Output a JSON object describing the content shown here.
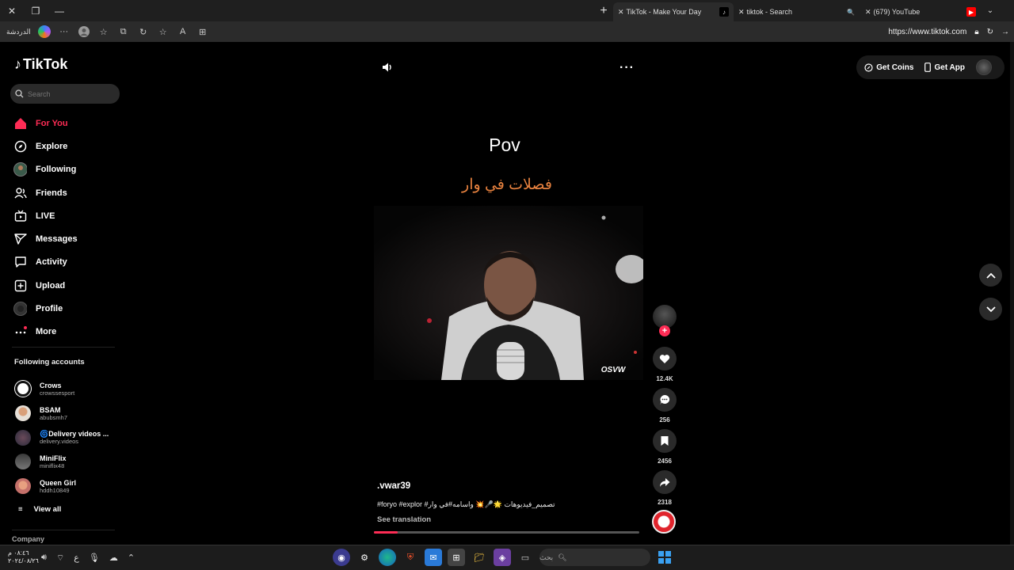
{
  "browser": {
    "tabs": [
      {
        "title": "TikTok - Make Your Day",
        "active": true
      },
      {
        "title": "tiktok - Search",
        "active": false
      },
      {
        "title": "(679) YouTube",
        "active": false
      }
    ],
    "profile_label": "الدردشة",
    "url": "https://www.tiktok.com"
  },
  "tiktok": {
    "logo": "TikTok",
    "search_placeholder": "Search",
    "nav": [
      {
        "label": "For You",
        "icon": "home-icon",
        "active": true
      },
      {
        "label": "Explore",
        "icon": "compass-icon"
      },
      {
        "label": "Following",
        "icon": "following-avatar-icon"
      },
      {
        "label": "Friends",
        "icon": "friends-icon"
      },
      {
        "label": "LIVE",
        "icon": "live-icon"
      },
      {
        "label": "Messages",
        "icon": "messages-icon"
      },
      {
        "label": "Activity",
        "icon": "activity-icon"
      },
      {
        "label": "Upload",
        "icon": "upload-icon"
      },
      {
        "label": "Profile",
        "icon": "profile-avatar-icon"
      },
      {
        "label": "More",
        "icon": "more-icon"
      }
    ],
    "following_title": "Following accounts",
    "following": [
      {
        "name": "Crows",
        "handle": "crowssesport"
      },
      {
        "name": "BSAM",
        "handle": "abubsmh7"
      },
      {
        "name": "🌀Delivery videos ...",
        "handle": "delivery.videos"
      },
      {
        "name": "MiniFlix",
        "handle": "miniflix48"
      },
      {
        "name": "Queen Girl",
        "handle": "hddh10849"
      }
    ],
    "view_all": "View all",
    "company": "Company",
    "top_right": {
      "coins": "Get Coins",
      "app": "Get App"
    },
    "video": {
      "title": "Pov",
      "subtitle": "فصلات في وار",
      "watermark": "OSVW",
      "username": ".vwar39",
      "caption": "#foryo #explor #تصميم_فيديوهات 🌟🎤💥 واسامه#في وار",
      "see_translation": "See translation",
      "progress": 0.09
    },
    "actions": {
      "likes": "12.4K",
      "comments": "256",
      "saves": "2456",
      "shares": "2318"
    }
  },
  "taskbar": {
    "time": "٠٨:٤٦ م",
    "date": "٢٠٢٤/٠٨/٢٦",
    "lang": "ع",
    "search_placeholder": "بحث"
  }
}
